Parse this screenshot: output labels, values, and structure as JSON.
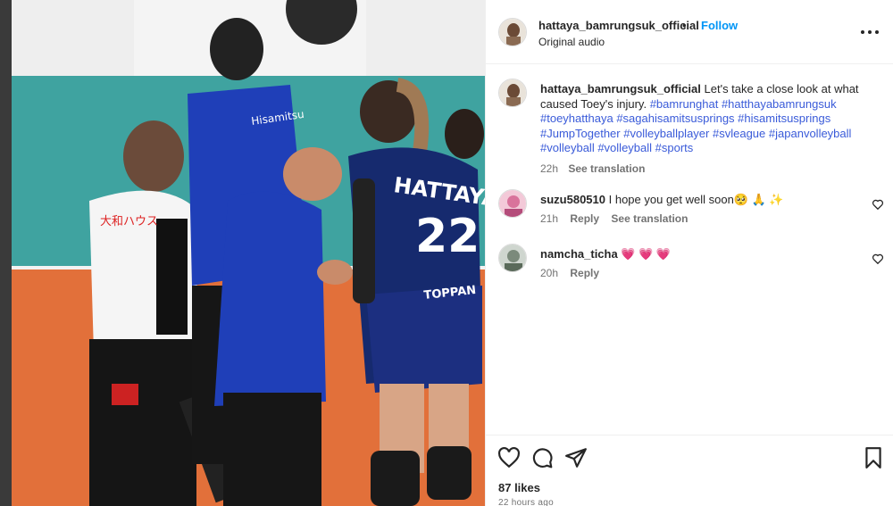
{
  "media": {
    "jersey_name": "HATTAYA",
    "jersey_number": "22",
    "shorts_sponsor": "TOPPAN",
    "sponsor_left": "Hisamitsu",
    "referee_badge": "大和ハウス"
  },
  "post": {
    "author": "hattaya_bamrungsuk_official",
    "dot": "•",
    "follow_label": "Follow",
    "audio_label": "Original audio"
  },
  "caption": {
    "username": "hattaya_bamrungsuk_official",
    "text": "Let's take a close look at what caused Toey's injury.",
    "hashtags": [
      "#bamrunghat",
      "#hatthayabamrungsuk",
      "#toeyhatthaya",
      "#sagahisamitsusprings",
      "#hisamitsusprings",
      "#JumpTogether",
      "#volleyballplayer",
      "#svleague",
      "#japanvolleyball",
      "#volleyball",
      "#volleyball",
      "#sports"
    ],
    "time": "22h",
    "translation_label": "See translation"
  },
  "comments": [
    {
      "username": "suzu580510",
      "text": "I hope you get well soon🥺 🙏 ✨",
      "time": "21h",
      "reply_label": "Reply",
      "translation_label": "See translation"
    },
    {
      "username": "namcha_ticha",
      "text": "💗 💗 💗",
      "time": "20h",
      "reply_label": "Reply"
    }
  ],
  "footer": {
    "likes": "87 likes",
    "time_ago": "22 hours ago"
  },
  "colors": {
    "link": "#0095f6",
    "hashtag": "#3a5bd9",
    "court_orange": "#e2703a",
    "court_teal": "#3fa3a0",
    "jersey_blue": "#1f3fb8"
  },
  "icons": [
    "more-options-icon",
    "heart-icon",
    "comment-icon",
    "share-icon",
    "bookmark-icon"
  ]
}
